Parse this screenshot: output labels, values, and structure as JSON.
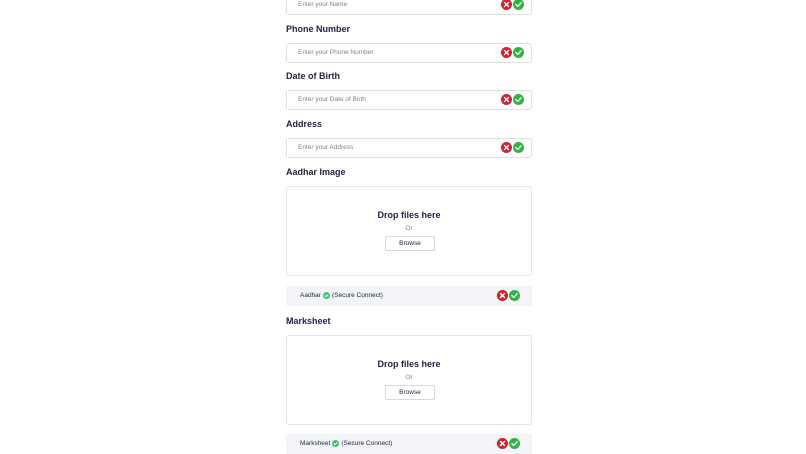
{
  "fields": [
    {
      "label": "",
      "placeholder": "Enter your Name"
    },
    {
      "label": "Phone Number",
      "placeholder": "Enter your Phone Number"
    },
    {
      "label": "Date of Birth",
      "placeholder": "Enter your Date of Birth"
    },
    {
      "label": "Address",
      "placeholder": "Enter your Address"
    }
  ],
  "uploads": [
    {
      "label": "Aadhar Image",
      "drop_text": "Drop files here",
      "or_text": "Or",
      "browse_label": "Browse",
      "file_name": "Aadhar",
      "file_status": "(Secure Connect)"
    },
    {
      "label": "Marksheet",
      "drop_text": "Drop files here",
      "or_text": "Or",
      "browse_label": "Browse",
      "file_name": "Marksheet",
      "file_status": "(Secure Connect)"
    }
  ],
  "icons": {
    "reject": "x-circle-icon",
    "accept": "check-circle-icon",
    "verified": "verified-dot-icon"
  },
  "colors": {
    "reject": "#d0202e",
    "accept": "#2fb543",
    "verified": "#3cc46b",
    "heading": "#1e2145"
  }
}
